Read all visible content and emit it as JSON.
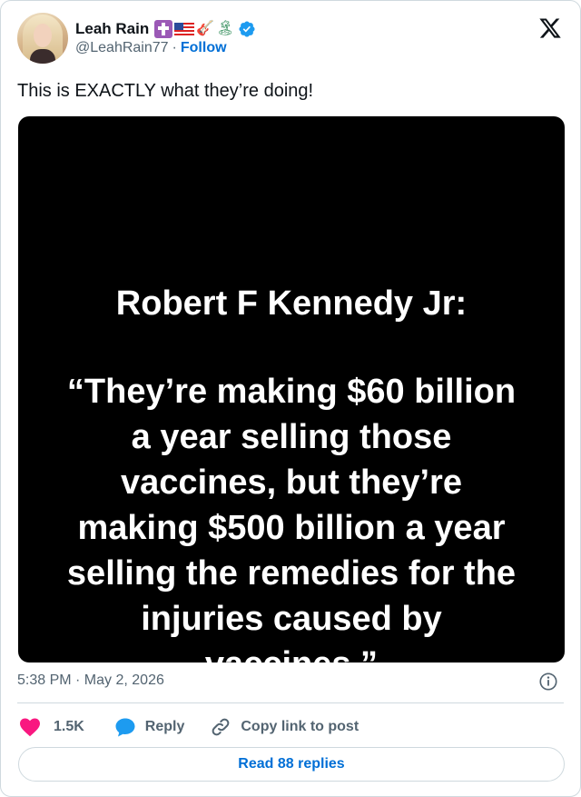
{
  "author": {
    "display_name": "Leah Rain",
    "emoji_icons": [
      "latin-cross-icon",
      "us-flag-icon",
      "guitar-icon",
      "desert-island-icon"
    ],
    "handle": "@LeahRain77",
    "separator": "·",
    "follow_label": "Follow",
    "verified": true
  },
  "tweet": {
    "text": "This is EXACTLY what they’re doing!",
    "timestamp": "5:38 PM · May 2, 2026"
  },
  "media": {
    "title": "Robert F Kennedy Jr:",
    "quote_lines": [
      "“They’re making $60 billion",
      "a year selling those",
      "vaccines, but they’re",
      "making $500 billion a year",
      "selling the remedies for the",
      "injuries caused by",
      "vaccines.”"
    ]
  },
  "actions": {
    "like_count": "1.5K",
    "reply_label": "Reply",
    "copy_label": "Copy link to post",
    "read_replies_label": "Read 88 replies"
  },
  "colors": {
    "like": "#f91880",
    "reply": "#1d9bf0",
    "link": "#006fd6",
    "verified": "#1d9bf0",
    "muted": "#536471",
    "border": "#cfd9de"
  }
}
